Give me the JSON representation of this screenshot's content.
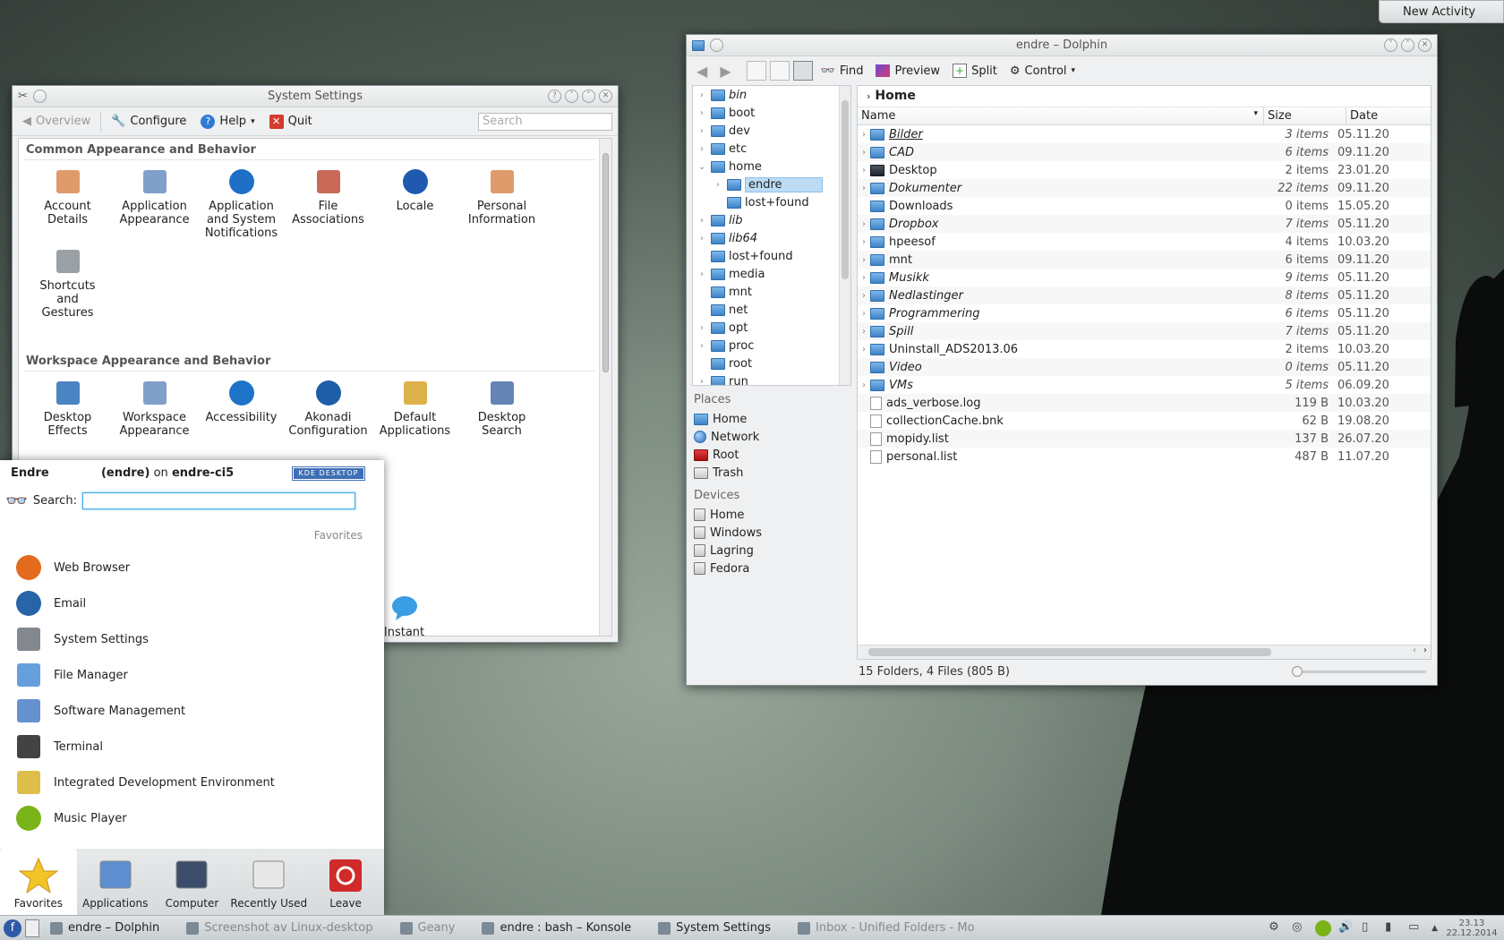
{
  "desktop": {
    "new_activity": "New Activity"
  },
  "system_settings": {
    "title": "System Settings",
    "toolbar": {
      "overview": "Overview",
      "configure": "Configure",
      "help": "Help",
      "quit": "Quit"
    },
    "search_placeholder": "Search",
    "sections": [
      {
        "title": "Common Appearance and Behavior",
        "items": [
          {
            "label": "Account\nDetails",
            "icon": "account-icon"
          },
          {
            "label": "Application\nAppearance",
            "icon": "app-appearance-icon"
          },
          {
            "label": "Application\nand System\nNotifications",
            "icon": "notifications-icon"
          },
          {
            "label": "File\nAssociations",
            "icon": "file-assoc-icon"
          },
          {
            "label": "Locale",
            "icon": "locale-icon"
          },
          {
            "label": "Personal\nInformation",
            "icon": "personal-info-icon"
          },
          {
            "label": "Shortcuts\nand\nGestures",
            "icon": "shortcuts-icon"
          }
        ]
      },
      {
        "title": "Workspace Appearance and Behavior",
        "items": [
          {
            "label": "Desktop\nEffects",
            "icon": "desktop-effects-icon"
          },
          {
            "label": "Workspace\nAppearance",
            "icon": "workspace-icon"
          },
          {
            "label": "Accessibility",
            "icon": "accessibility-icon"
          },
          {
            "label": "Akonadi\nConfiguration",
            "icon": "akonadi-icon"
          },
          {
            "label": "Default\nApplications",
            "icon": "default-apps-icon"
          },
          {
            "label": "Desktop\nSearch",
            "icon": "desktop-search-icon"
          }
        ]
      }
    ],
    "partial_item": "Instant"
  },
  "dolphin": {
    "title": "endre – Dolphin",
    "toolbar": {
      "find": "Find",
      "preview": "Preview",
      "split": "Split",
      "control": "Control"
    },
    "tree": [
      {
        "name": "bin",
        "italic": true,
        "exp": ">"
      },
      {
        "name": "boot",
        "exp": ">"
      },
      {
        "name": "dev",
        "exp": ">"
      },
      {
        "name": "etc",
        "exp": ">"
      },
      {
        "name": "home",
        "exp": "v"
      },
      {
        "name": "endre",
        "indent": 1,
        "exp": ">",
        "selected": true
      },
      {
        "name": "lost+found",
        "indent": 1,
        "exp": ""
      },
      {
        "name": "lib",
        "italic": true,
        "exp": ">"
      },
      {
        "name": "lib64",
        "italic": true,
        "exp": ">"
      },
      {
        "name": "lost+found",
        "exp": ""
      },
      {
        "name": "media",
        "exp": ">"
      },
      {
        "name": "mnt",
        "exp": ""
      },
      {
        "name": "net",
        "exp": ""
      },
      {
        "name": "opt",
        "exp": ">"
      },
      {
        "name": "proc",
        "exp": ">"
      },
      {
        "name": "root",
        "exp": ""
      },
      {
        "name": "run",
        "exp": ">"
      }
    ],
    "places_title": "Places",
    "places": [
      {
        "name": "Home",
        "kind": ""
      },
      {
        "name": "Network",
        "kind": "globe"
      },
      {
        "name": "Root",
        "kind": "red"
      },
      {
        "name": "Trash",
        "kind": "drive"
      }
    ],
    "devices_title": "Devices",
    "devices": [
      "Home",
      "Windows",
      "Lagring",
      "Fedora"
    ],
    "breadcrumb": "Home",
    "columns": {
      "name": "Name",
      "size": "Size",
      "date": "Date"
    },
    "files": [
      {
        "name": "Bilder",
        "size": "3 items",
        "date": "05.11.20",
        "italic": true,
        "underline": true,
        "folder": true
      },
      {
        "name": "CAD",
        "size": "6 items",
        "date": "09.11.20",
        "italic": true,
        "folder": true
      },
      {
        "name": "Desktop",
        "size": "2 items",
        "date": "23.01.20",
        "folder": true,
        "dark": true
      },
      {
        "name": "Dokumenter",
        "size": "22 items",
        "date": "09.11.20",
        "italic": true,
        "folder": true
      },
      {
        "name": "Downloads",
        "size": "0 items",
        "date": "15.05.20",
        "folder": true,
        "noexp": true
      },
      {
        "name": "Dropbox",
        "size": "7 items",
        "date": "05.11.20",
        "italic": true,
        "folder": true
      },
      {
        "name": "hpeesof",
        "size": "4 items",
        "date": "10.03.20",
        "folder": true
      },
      {
        "name": "mnt",
        "size": "6 items",
        "date": "09.11.20",
        "folder": true
      },
      {
        "name": "Musikk",
        "size": "9 items",
        "date": "05.11.20",
        "italic": true,
        "folder": true
      },
      {
        "name": "Nedlastinger",
        "size": "8 items",
        "date": "05.11.20",
        "italic": true,
        "folder": true
      },
      {
        "name": "Programmering",
        "size": "6 items",
        "date": "05.11.20",
        "italic": true,
        "folder": true
      },
      {
        "name": "Spill",
        "size": "7 items",
        "date": "05.11.20",
        "italic": true,
        "folder": true
      },
      {
        "name": "Uninstall_ADS2013.06",
        "size": "2 items",
        "date": "10.03.20",
        "folder": true
      },
      {
        "name": "Video",
        "size": "0 items",
        "date": "05.11.20",
        "italic": true,
        "folder": true,
        "noexp": true
      },
      {
        "name": "VMs",
        "size": "5 items",
        "date": "06.09.20",
        "italic": true,
        "folder": true
      },
      {
        "name": "ads_verbose.log",
        "size": "119 B",
        "date": "10.03.20"
      },
      {
        "name": "collectionCache.bnk",
        "size": "62 B",
        "date": "19.08.20"
      },
      {
        "name": "mopidy.list",
        "size": "137 B",
        "date": "26.07.20"
      },
      {
        "name": "personal.list",
        "size": "487 B",
        "date": "11.07.20"
      }
    ],
    "status": "15 Folders, 4 Files (805 B)"
  },
  "kickoff": {
    "user_name": "Endre",
    "user_login": "(endre)",
    "on": "on",
    "host": "endre-ci5",
    "badge": "KDE DESKTOP",
    "search_label": "Search:",
    "favorites_label": "Favorites",
    "items": [
      {
        "label": "Web Browser",
        "icon": "firefox-icon"
      },
      {
        "label": "Email",
        "icon": "thunderbird-icon"
      },
      {
        "label": "System Settings",
        "icon": "system-settings-icon"
      },
      {
        "label": "File Manager",
        "icon": "file-manager-icon"
      },
      {
        "label": "Software Management",
        "icon": "software-mgmt-icon"
      },
      {
        "label": "Terminal",
        "icon": "terminal-icon"
      },
      {
        "label": "Integrated Development Environment",
        "icon": "ide-icon"
      },
      {
        "label": "Music Player",
        "icon": "spotify-icon"
      }
    ],
    "tabs": [
      "Favorites",
      "Applications",
      "Computer",
      "Recently Used",
      "Leave"
    ]
  },
  "taskbar": {
    "tasks": [
      {
        "label": "endre – Dolphin",
        "dim": false
      },
      {
        "label": "Screenshot av Linux-desktop",
        "dim": true
      },
      {
        "label": "Geany",
        "dim": true
      },
      {
        "label": "endre : bash – Konsole",
        "dim": false
      },
      {
        "label": "System Settings",
        "dim": false
      },
      {
        "label": "Inbox - Unified Folders - Mo",
        "dim": true
      }
    ],
    "clock_time": "23.13",
    "clock_date": "22.12.2014"
  }
}
